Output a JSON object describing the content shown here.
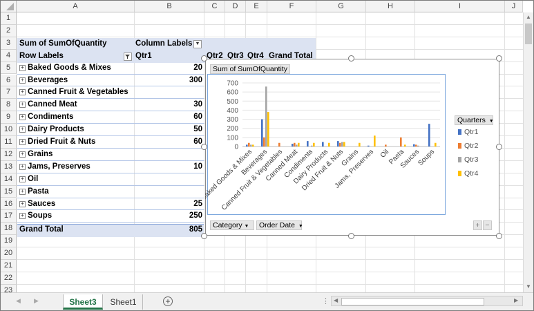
{
  "columns": [
    "A",
    "B",
    "C",
    "D",
    "E",
    "F",
    "G",
    "H",
    "I",
    "J"
  ],
  "rows": [
    "1",
    "2",
    "3",
    "4",
    "5",
    "6",
    "7",
    "8",
    "9",
    "10",
    "11",
    "12",
    "13",
    "14",
    "15",
    "16",
    "17",
    "18",
    "19",
    "20",
    "21",
    "22",
    "23"
  ],
  "pivot": {
    "header_label": "Sum of SumOfQuantity",
    "column_labels": "Column Labels",
    "row_labels": "Row Labels",
    "qtr_headers": [
      "Qtr1",
      "Qtr2",
      "Qtr3",
      "Qtr4",
      "Grand Total"
    ],
    "items": [
      {
        "label": "Baked Goods & Mixes",
        "qtr1": "20"
      },
      {
        "label": "Beverages",
        "qtr1": "300"
      },
      {
        "label": "Canned Fruit & Vegetables",
        "qtr1": ""
      },
      {
        "label": "Canned Meat",
        "qtr1": "30"
      },
      {
        "label": "Condiments",
        "qtr1": "60"
      },
      {
        "label": "Dairy Products",
        "qtr1": "50"
      },
      {
        "label": "Dried Fruit & Nuts",
        "qtr1": "60"
      },
      {
        "label": "Grains",
        "qtr1": ""
      },
      {
        "label": "Jams, Preserves",
        "qtr1": "10"
      },
      {
        "label": "Oil",
        "qtr1": ""
      },
      {
        "label": "Pasta",
        "qtr1": ""
      },
      {
        "label": "Sauces",
        "qtr1": "25"
      },
      {
        "label": "Soups",
        "qtr1": "250"
      }
    ],
    "grand_total_label": "Grand Total",
    "grand_total_qtr1": "805",
    "expand_symbol": "+"
  },
  "chart": {
    "value_field_button": "Sum of SumOfQuantity",
    "legend_title": "Quarters",
    "category_button": "Category",
    "order_date_button": "Order Date",
    "zoom_plus": "+",
    "zoom_minus": "−"
  },
  "chart_data": {
    "type": "bar",
    "title": "",
    "categories": [
      "Baked Goods & Mixes",
      "Beverages",
      "Canned Fruit & Vegetables",
      "Canned Meat",
      "Condiments",
      "Dairy Products",
      "Dried Fruit & Nuts",
      "Grains",
      "Jams, Preserves",
      "Oil",
      "Pasta",
      "Sauces",
      "Soups"
    ],
    "series": [
      {
        "name": "Qtr1",
        "color": "#4472c4",
        "values": [
          20,
          300,
          0,
          30,
          60,
          50,
          60,
          0,
          10,
          0,
          0,
          25,
          250
        ]
      },
      {
        "name": "Qtr2",
        "color": "#ed7d31",
        "values": [
          40,
          100,
          40,
          40,
          0,
          0,
          40,
          0,
          0,
          20,
          100,
          20,
          0
        ]
      },
      {
        "name": "Qtr3",
        "color": "#a5a5a5",
        "values": [
          20,
          660,
          0,
          20,
          10,
          0,
          50,
          0,
          0,
          0,
          0,
          10,
          0
        ]
      },
      {
        "name": "Qtr4",
        "color": "#ffc000",
        "values": [
          20,
          380,
          0,
          40,
          40,
          40,
          50,
          40,
          120,
          0,
          20,
          0,
          40
        ]
      }
    ],
    "yticks": [
      "0",
      "100",
      "200",
      "300",
      "400",
      "500",
      "600",
      "700"
    ],
    "ylim": [
      0,
      700
    ],
    "legend_position": "right"
  },
  "sheet_tabs": [
    "Sheet3",
    "Sheet1"
  ],
  "add_sheet_symbol": "+"
}
